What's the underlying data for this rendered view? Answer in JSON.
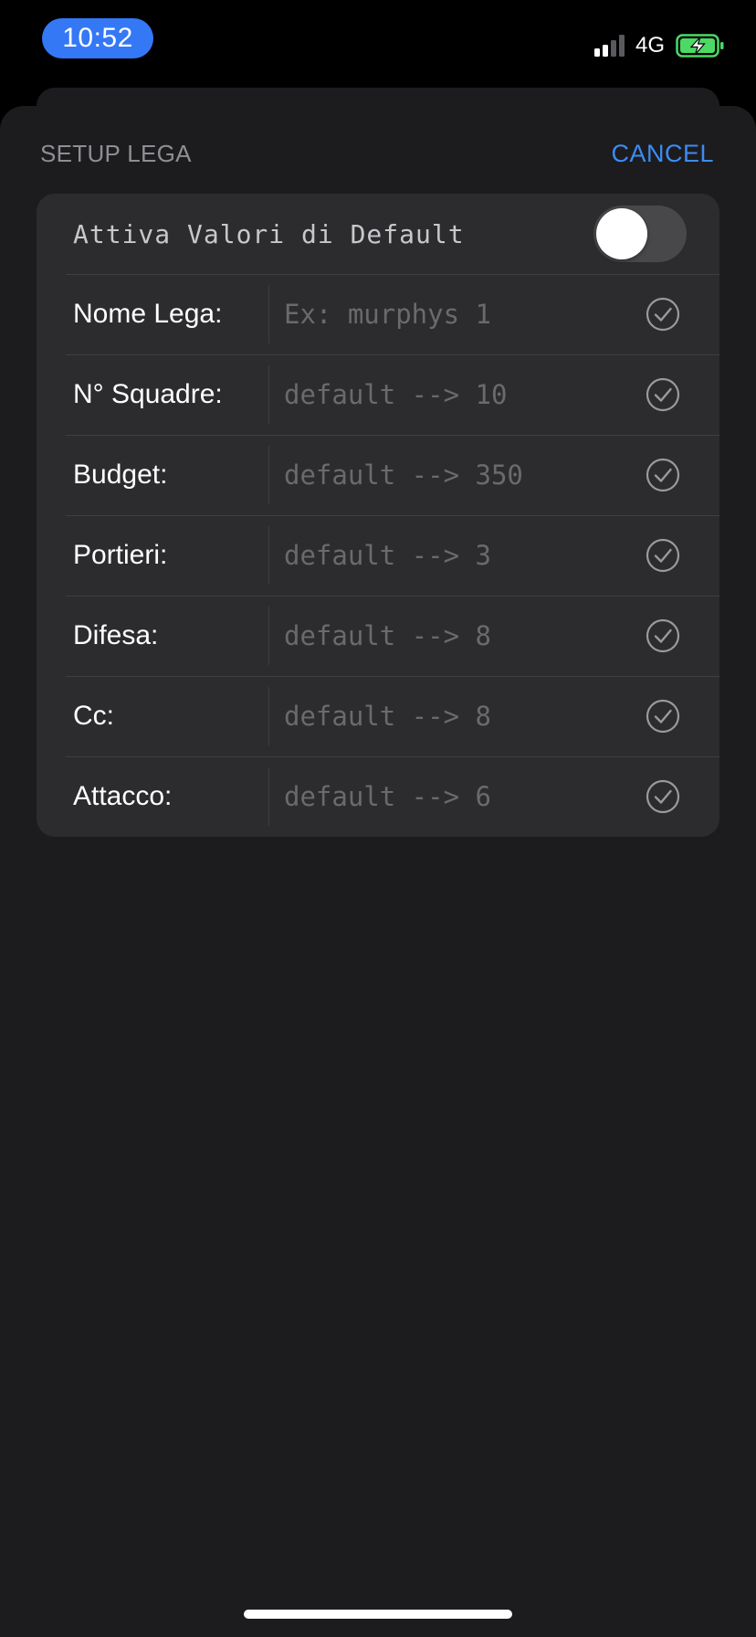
{
  "status_bar": {
    "time": "10:52",
    "network": "4G",
    "time_pill_color": "#3478f6",
    "battery_color": "#4cd964",
    "icons": [
      "signal-icon",
      "battery-charging-icon"
    ]
  },
  "sheet": {
    "title": "SETUP LEGA",
    "cancel_label": "CANCEL",
    "accent_color": "#3d8bf5"
  },
  "form": {
    "default_toggle": {
      "label": "Attiva Valori di Default",
      "on": false
    },
    "fields": [
      {
        "label": "Nome Lega:",
        "placeholder": "Ex: murphys 1",
        "value": ""
      },
      {
        "label": "N° Squadre:",
        "placeholder": "default --> 10",
        "value": ""
      },
      {
        "label": "Budget:",
        "placeholder": "default --> 350",
        "value": ""
      },
      {
        "label": "Portieri:",
        "placeholder": "default --> 3",
        "value": ""
      },
      {
        "label": "Difesa:",
        "placeholder": "default --> 8",
        "value": ""
      },
      {
        "label": "Cc:",
        "placeholder": "default --> 8",
        "value": ""
      },
      {
        "label": "Attacco:",
        "placeholder": "default --> 6",
        "value": ""
      }
    ],
    "field_icon": "checkmark-circle-icon"
  }
}
